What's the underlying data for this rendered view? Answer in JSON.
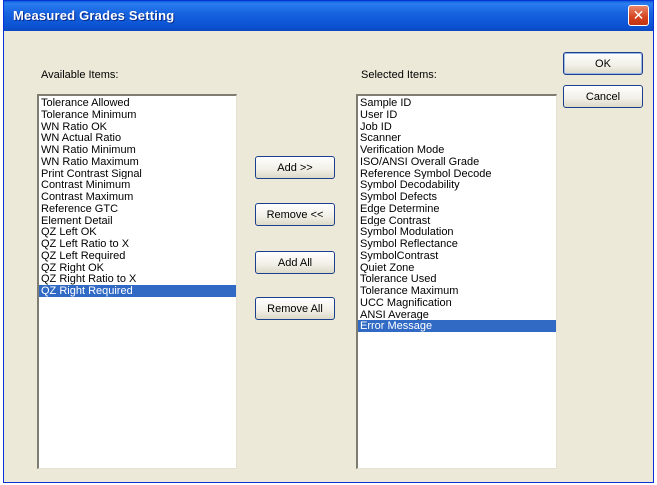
{
  "window": {
    "title": "Measured Grades Setting"
  },
  "available": {
    "label": "Available Items:",
    "items": [
      "Tolerance Allowed",
      "Tolerance Minimum",
      "WN Ratio OK",
      "WN Actual Ratio",
      "WN Ratio Minimum",
      "WN Ratio Maximum",
      "Print Contrast Signal",
      "Contrast Minimum",
      "Contrast Maximum",
      "Reference GTC",
      "Element Detail",
      "QZ Left OK",
      "QZ Left Ratio to X",
      "QZ Left Required",
      "QZ Right OK",
      "QZ Right Ratio to X",
      "QZ Right Required"
    ],
    "selected_index": 16
  },
  "selected": {
    "label": "Selected Items:",
    "items": [
      "Sample ID",
      "User ID",
      "Job ID",
      "Scanner",
      "Verification Mode",
      "ISO/ANSI Overall Grade",
      "Reference Symbol Decode",
      "Symbol Decodability",
      "Symbol Defects",
      "Edge Determine",
      "Edge Contrast",
      "Symbol Modulation",
      "Symbol Reflectance",
      "SymbolContrast",
      "Quiet Zone",
      "Tolerance Used",
      "Tolerance Maximum",
      "UCC Magnification",
      "ANSI Average",
      "Error Message"
    ],
    "selected_index": 19
  },
  "buttons": {
    "add": "Add >>",
    "remove": "Remove <<",
    "add_all": "Add All",
    "remove_all": "Remove All",
    "ok": "OK",
    "cancel": "Cancel"
  }
}
